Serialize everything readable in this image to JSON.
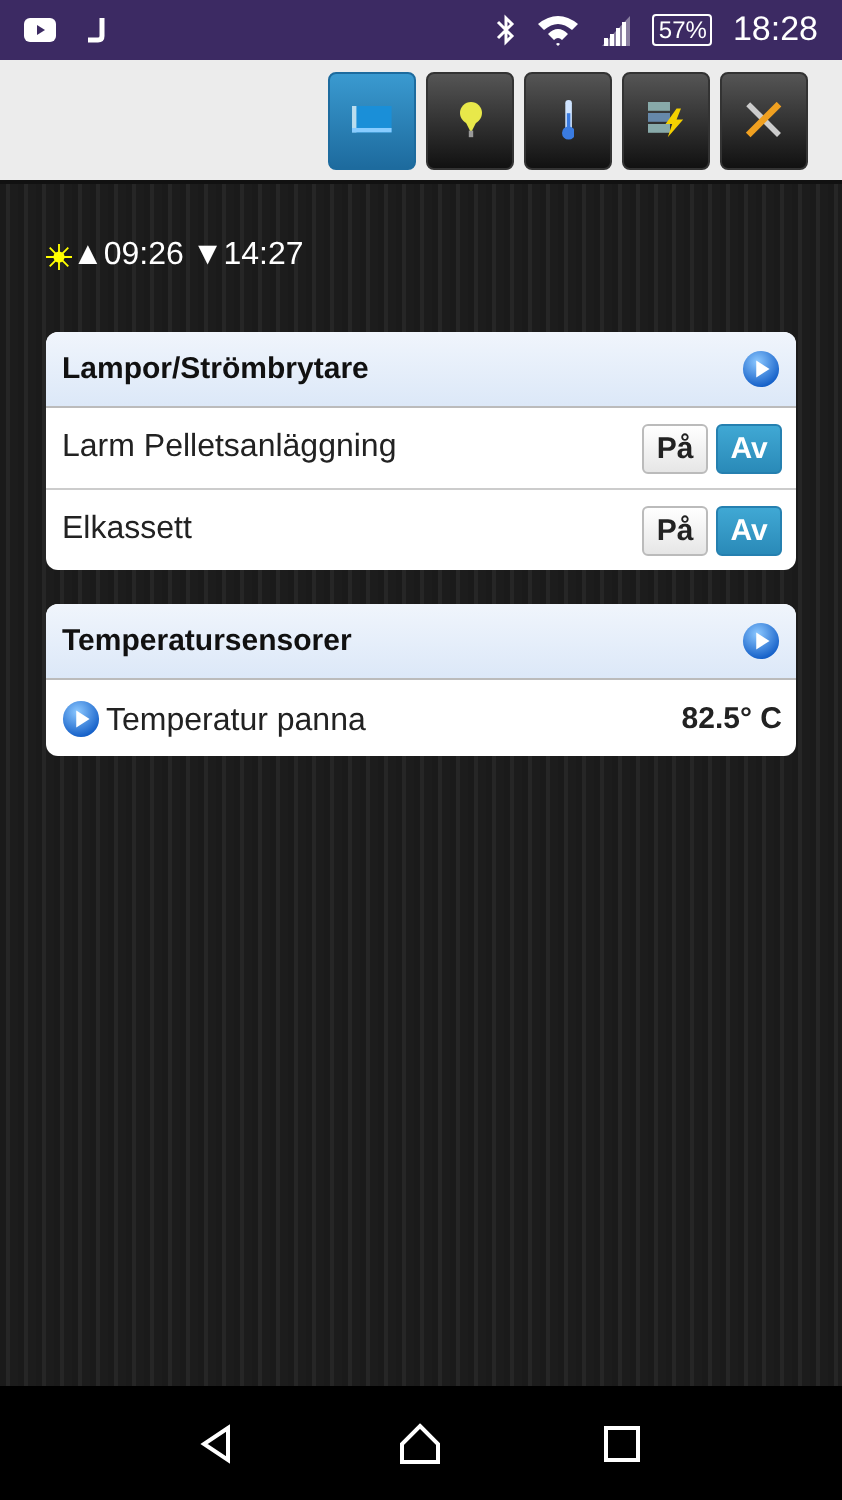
{
  "status_bar": {
    "battery": "57%",
    "time": "18:28"
  },
  "toolbar": [
    {
      "selected": true
    },
    {
      "selected": false
    },
    {
      "selected": false
    },
    {
      "selected": false
    },
    {
      "selected": false
    }
  ],
  "sun": {
    "sunrise": "▲09:26",
    "sunset": "▼14:27"
  },
  "groups": [
    {
      "kind": "switches",
      "title": "Lampor/Strömbrytare",
      "items": [
        {
          "label": "Larm Pelletsanläggning",
          "buttons": [
            {
              "label": "På",
              "selected": false
            },
            {
              "label": "Av",
              "selected": true
            }
          ]
        },
        {
          "label": "Elkassett",
          "buttons": [
            {
              "label": "På",
              "selected": false
            },
            {
              "label": "Av",
              "selected": true
            }
          ]
        }
      ]
    },
    {
      "kind": "sensors",
      "title": "Temperatursensorer",
      "items": [
        {
          "label": "Temperatur panna",
          "value": "82.5° C"
        }
      ]
    }
  ]
}
